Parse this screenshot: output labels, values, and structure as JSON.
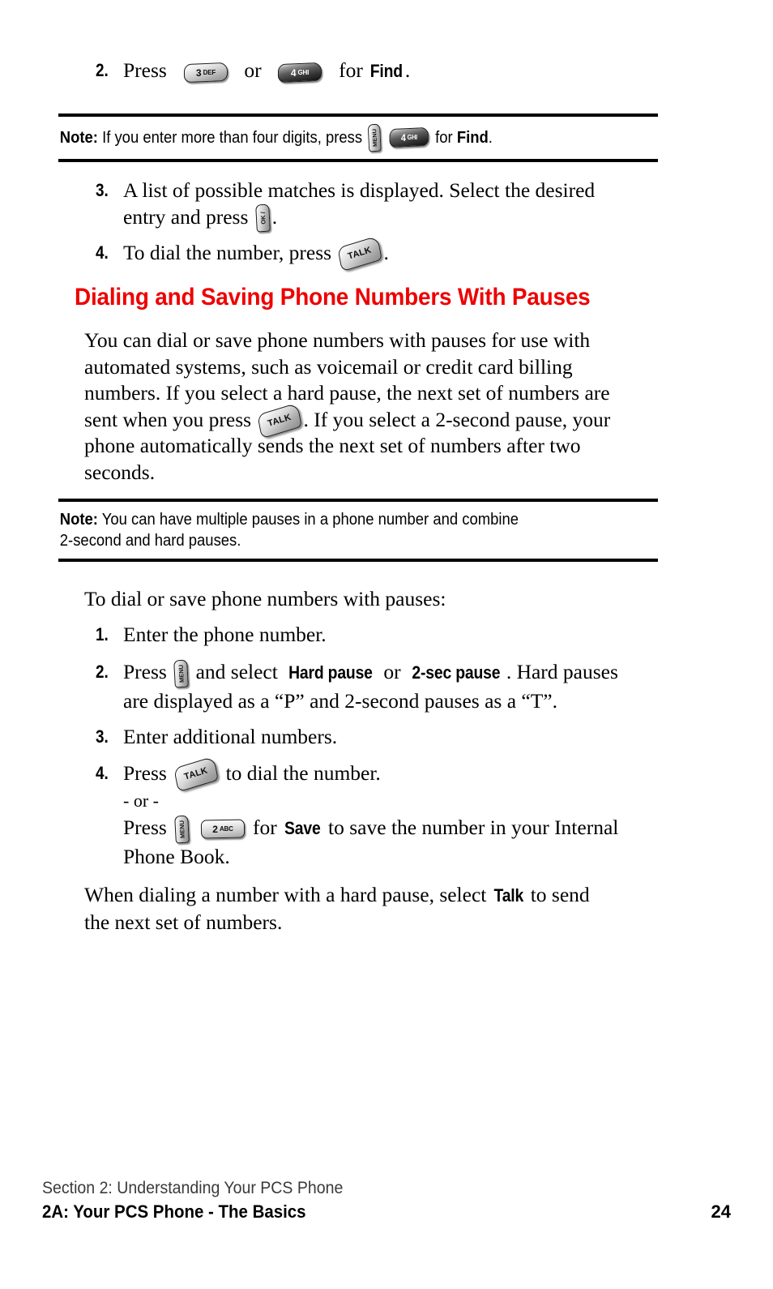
{
  "page": {
    "number": "24",
    "heading": "Dialing and Saving Phone Numbers With Pauses"
  },
  "keys": {
    "three_def": {
      "digit": "3",
      "letters": "DEF",
      "name": "key-3-def"
    },
    "four_ghi": {
      "digit": "4",
      "letters": "GHI",
      "name": "key-4-ghi"
    },
    "two_abc": {
      "digit": "2",
      "letters": "ABC",
      "name": "key-2-abc"
    },
    "menu": {
      "label": "MENU",
      "name": "key-menu"
    },
    "ok": {
      "label": "OK /",
      "name": "key-ok"
    },
    "talk": {
      "label": "TALK",
      "name": "key-talk"
    }
  },
  "top_step": {
    "number": "2.",
    "text_before": "Press",
    "text_or": "or",
    "text_for": "for",
    "bold_target": "Find",
    "text_end": "."
  },
  "note_one": {
    "lead": "Note:",
    "part1": "If you enter more than four digits, press",
    "part2": "for",
    "bold_target": "Find",
    "part3": "."
  },
  "steps_top": [
    {
      "number": "3.",
      "line1": "A list of possible matches is displayed. Select the desired",
      "line2_before": "entry and press",
      "line2_after": "."
    },
    {
      "number": "4.",
      "text_before": "To dial the number, press",
      "text_after": "."
    }
  ],
  "intro_paragraph": {
    "line1": "You can dial or save phone numbers with pauses for use with",
    "line2": "automated systems, such as voicemail or credit card billing",
    "line3": "numbers. If you select a hard pause, the next set of numbers are",
    "line4_before": "sent when you press",
    "line4_after": ". If you select a 2-second pause, your",
    "line5": "phone automatically sends the next set of numbers after two",
    "line6": "seconds."
  },
  "note_two": {
    "lead": "Note:",
    "line1": "You can have multiple pauses in a phone number and combine",
    "line2": "2-second and hard pauses."
  },
  "lead_in": "To dial or save phone numbers with pauses:",
  "steps_bottom": [
    {
      "number": "1.",
      "text": "Enter the phone number."
    },
    {
      "number": "2.",
      "text_before": "Press",
      "text_mid": "and select",
      "bold_a": "Hard pause",
      "text_or": "or",
      "bold_b": "2-sec pause",
      "text_after": ". Hard pauses",
      "line2": "are displayed as a “P” and 2-second pauses as a “T”."
    },
    {
      "number": "3.",
      "text": "Enter additional numbers."
    },
    {
      "number": "4.",
      "text_before": "Press",
      "text_after": "to dial the number.",
      "or_text": "- or -",
      "alt_before": "Press",
      "alt_mid": "for",
      "alt_bold": "Save",
      "alt_after": "to save the number in your Internal",
      "alt_line2": "Phone Book."
    }
  ],
  "closing_paragraph": {
    "line1_before": "When dialing a number with a hard pause, select",
    "line1_bold": "Talk",
    "line1_after": "to send",
    "line2": "the next set of numbers."
  },
  "footer": {
    "section": "Section 2: Understanding Your PCS Phone",
    "chapter": "2A: Your PCS Phone - The Basics",
    "page_number": "24"
  },
  "colors": {
    "heading_red": "#ee0000",
    "text_black": "#000000",
    "footer_gray": "#3b3b3b"
  }
}
